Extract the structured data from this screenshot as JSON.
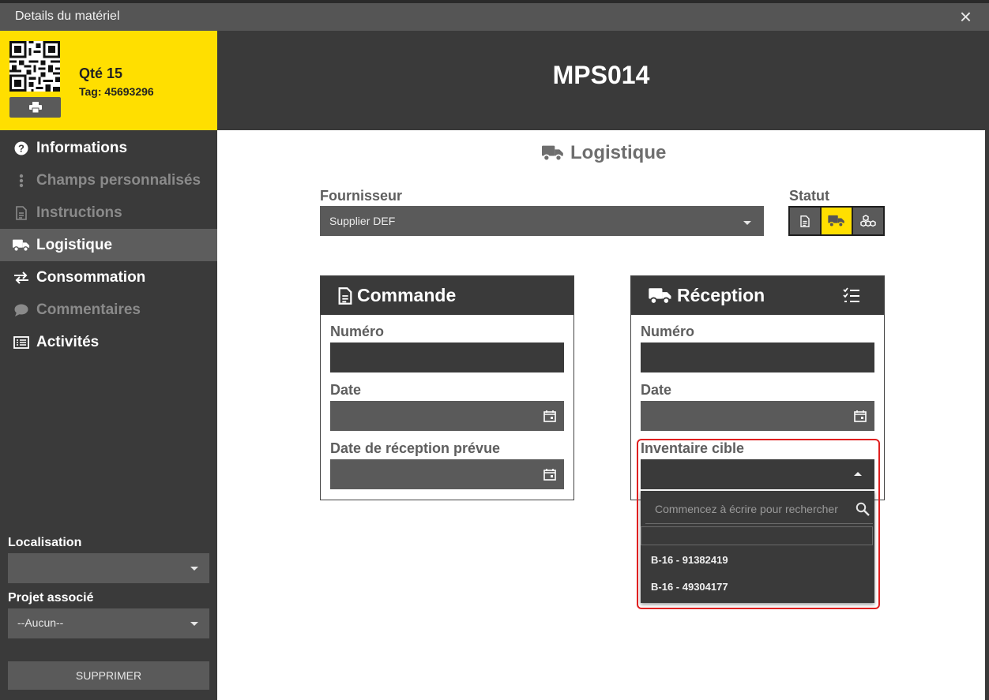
{
  "window": {
    "title": "Details du matériel",
    "close_icon": "×"
  },
  "item": {
    "qty": "Qté 15",
    "tag": "Tag: 45693296",
    "code": "MPS014"
  },
  "nav": [
    {
      "label": "Informations"
    },
    {
      "label": "Champs personnalisés"
    },
    {
      "label": "Instructions"
    },
    {
      "label": "Logistique"
    },
    {
      "label": "Consommation"
    },
    {
      "label": "Commentaires"
    },
    {
      "label": "Activités"
    }
  ],
  "left_panel": {
    "location_label": "Localisation",
    "location_value": "",
    "project_label": "Projet associé",
    "project_value": "--Aucun--",
    "delete_label": "SUPPRIMER"
  },
  "logistics": {
    "title": "Logistique",
    "supplier_label": "Fournisseur",
    "supplier_value": "Supplier DEF",
    "status_label": "Statut"
  },
  "order": {
    "title": "Commande",
    "number_label": "Numéro",
    "date_label": "Date",
    "expected_label": "Date de réception prévue"
  },
  "reception": {
    "title": "Réception",
    "number_label": "Numéro",
    "date_label": "Date",
    "inventory_label": "Inventaire cible",
    "search_placeholder": "Commencez à écrire pour rechercher",
    "options": [
      "B-16 - 91382419",
      "B-16 - 49304177"
    ]
  },
  "colors": {
    "accent": "#ffdf00",
    "dark": "#3a3a3a",
    "highlight": "#e02020"
  }
}
